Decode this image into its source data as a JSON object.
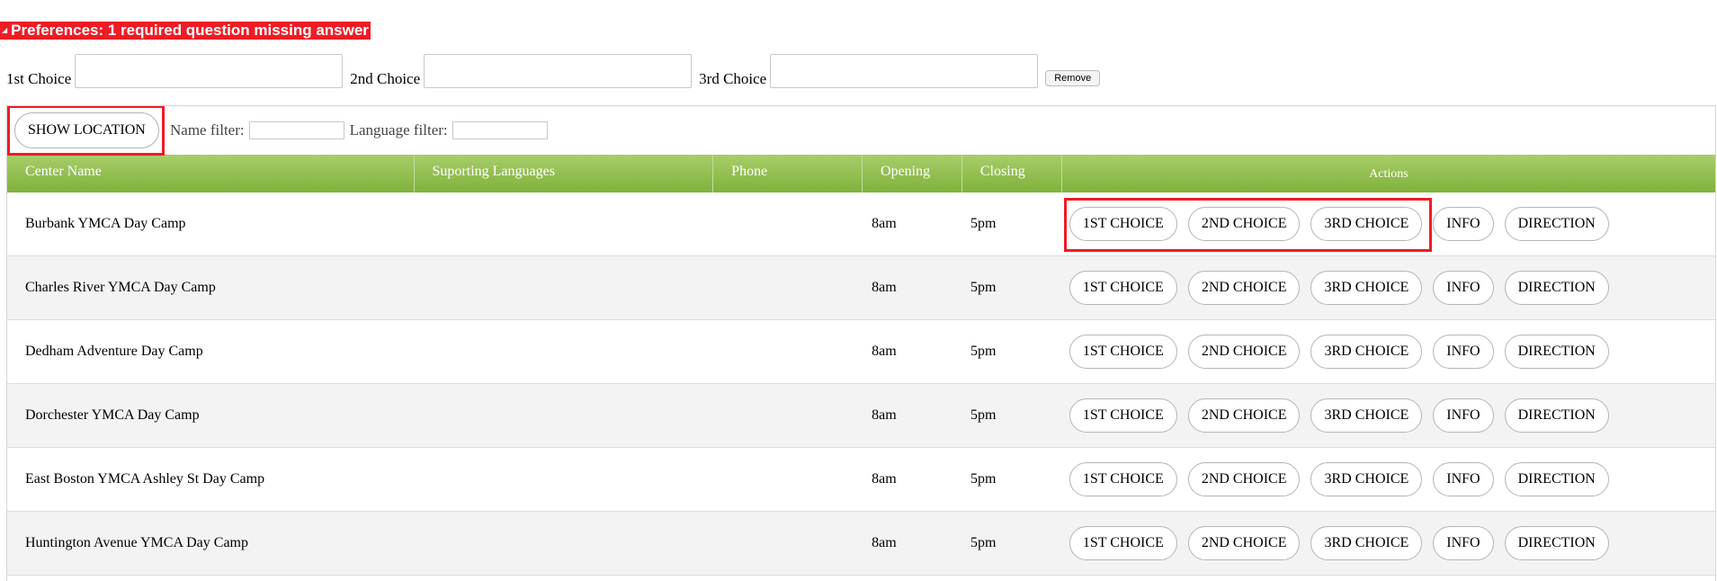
{
  "preferences": {
    "banner": "Preferences: 1 required question missing answer",
    "choices": [
      {
        "label": "1st Choice",
        "value": ""
      },
      {
        "label": "2nd Choice",
        "value": ""
      },
      {
        "label": "3rd Choice",
        "value": ""
      }
    ],
    "remove_label": "Remove"
  },
  "filters": {
    "show_location_label": "SHOW LOCATION",
    "name_filter_label": "Name filter:",
    "name_filter_value": "",
    "language_filter_label": "Language filter:",
    "language_filter_value": ""
  },
  "table": {
    "columns": [
      "Center Name",
      "Suporting Languages",
      "Phone",
      "Opening",
      "Closing",
      "Actions"
    ],
    "action_labels": [
      "1ST CHOICE",
      "2ND CHOICE",
      "3RD CHOICE",
      "INFO",
      "DIRECTION"
    ],
    "rows": [
      {
        "name": "Burbank YMCA Day Camp",
        "languages": "",
        "phone": "",
        "opening": "8am",
        "closing": "5pm"
      },
      {
        "name": "Charles River YMCA Day Camp",
        "languages": "",
        "phone": "",
        "opening": "8am",
        "closing": "5pm"
      },
      {
        "name": "Dedham Adventure Day Camp",
        "languages": "",
        "phone": "",
        "opening": "8am",
        "closing": "5pm"
      },
      {
        "name": "Dorchester YMCA Day Camp",
        "languages": "",
        "phone": "",
        "opening": "8am",
        "closing": "5pm"
      },
      {
        "name": "East Boston YMCA Ashley St Day Camp",
        "languages": "",
        "phone": "",
        "opening": "8am",
        "closing": "5pm"
      },
      {
        "name": "Huntington Avenue YMCA Day Camp",
        "languages": "",
        "phone": "",
        "opening": "8am",
        "closing": "5pm"
      }
    ]
  },
  "colors": {
    "alert_red": "#ee1c25",
    "header_green": "#8fbe4a",
    "alt_row": "#f3f3f3"
  }
}
